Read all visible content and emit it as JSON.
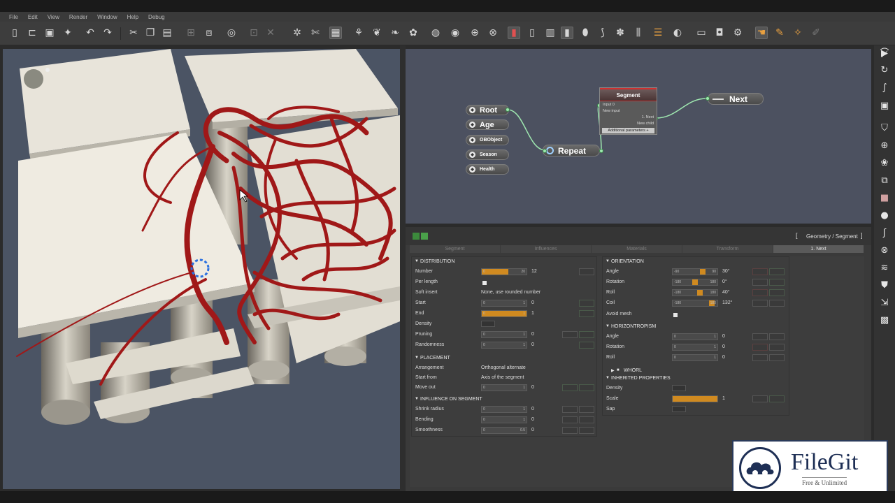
{
  "menu": [
    "File",
    "Edit",
    "View",
    "Render",
    "Window",
    "Help",
    "Debug"
  ],
  "graph": {
    "nodes": {
      "root": "Root",
      "age": "Age",
      "objobject": "OBObject",
      "season": "Season",
      "health": "Health",
      "repeat": "Repeat",
      "next": "Next"
    },
    "segment": {
      "title": "Segment",
      "in_input": "Input 0",
      "in_new": "New input",
      "out_next": "1. Next",
      "out_child": "New child",
      "footer": "Additional parameters +"
    }
  },
  "props": {
    "breadcrumb": "Geometry / Segment",
    "tabs": [
      "Segment",
      "Influences",
      "Materials",
      "Transform",
      "1. Next"
    ],
    "active_tab": "1. Next",
    "distribution": {
      "title": "DISTRIBUTION",
      "number": {
        "label": "Number",
        "value": "12",
        "min": "0",
        "max": "20",
        "fraction": 0.6
      },
      "per_length": {
        "label": "Per length"
      },
      "soft_insert": {
        "label": "Soft insert",
        "value": "None, use rounded number"
      },
      "start": {
        "label": "Start",
        "value": "0",
        "min": "0",
        "max": "1",
        "fraction": 0
      },
      "end": {
        "label": "End",
        "value": "1",
        "min": "0",
        "max": "1",
        "fraction": 1
      },
      "density": {
        "label": "Density"
      },
      "pruning": {
        "label": "Pruning",
        "value": "0",
        "min": "0",
        "max": "1",
        "fraction": 0
      },
      "randomness": {
        "label": "Randomness",
        "value": "0",
        "min": "0",
        "max": "1",
        "fraction": 0
      }
    },
    "placement": {
      "title": "PLACEMENT",
      "arrangement": {
        "label": "Arrangement",
        "value": "Orthogonal alternate"
      },
      "start_from": {
        "label": "Start from",
        "value": "Axis of the segment"
      },
      "move_out": {
        "label": "Move out",
        "value": "0",
        "min": "0",
        "max": "1",
        "fraction": 0
      }
    },
    "influence": {
      "title": "INFLUENCE ON SEGMENT",
      "shrink": {
        "label": "Shrink radius",
        "value": "0",
        "min": "0",
        "max": "1",
        "fraction": 0
      },
      "bending": {
        "label": "Bending",
        "value": "0",
        "min": "0",
        "max": "1",
        "fraction": 0
      },
      "smoothness": {
        "label": "Smoothness",
        "value": "0",
        "min": "0",
        "max": "0.5",
        "fraction": 0
      }
    },
    "orientation": {
      "title": "ORIENTATION",
      "angle": {
        "label": "Angle",
        "value": "30°",
        "min": "-90",
        "max": "90",
        "fraction": 0.67
      },
      "rotation": {
        "label": "Rotation",
        "value": "0°",
        "min": "-180",
        "max": "180",
        "fraction": 0.5
      },
      "roll": {
        "label": "Roll",
        "value": "40°",
        "min": "-180",
        "max": "180",
        "fraction": 0.61
      },
      "coil": {
        "label": "Coil",
        "value": "132°",
        "min": "-180",
        "max": "180",
        "fraction": 0.87
      },
      "avoid_mesh": {
        "label": "Avoid mesh"
      }
    },
    "horizontropism": {
      "title": "HORIZONTROPISM",
      "angle": {
        "label": "Angle",
        "value": "0",
        "min": "0",
        "max": "1",
        "fraction": 0
      },
      "rotation": {
        "label": "Rotation",
        "value": "0",
        "min": "0",
        "max": "1",
        "fraction": 0
      },
      "roll": {
        "label": "Roll",
        "value": "0",
        "min": "0",
        "max": "1",
        "fraction": 0
      }
    },
    "whorl": {
      "title": "WHORL"
    },
    "inherited": {
      "title": "INHERITED PROPERTIES",
      "density": {
        "label": "Density"
      },
      "scale": {
        "label": "Scale",
        "value": "1",
        "fraction": 1
      },
      "sap": {
        "label": "Sap"
      }
    }
  },
  "watermark": {
    "title": "FileGit",
    "subtitle": "Free & Unlimited"
  },
  "colors": {
    "accent": "#d08a20",
    "graph_bg": "#4c5160",
    "branch": "#a01818",
    "link": "#9fe8b0"
  }
}
